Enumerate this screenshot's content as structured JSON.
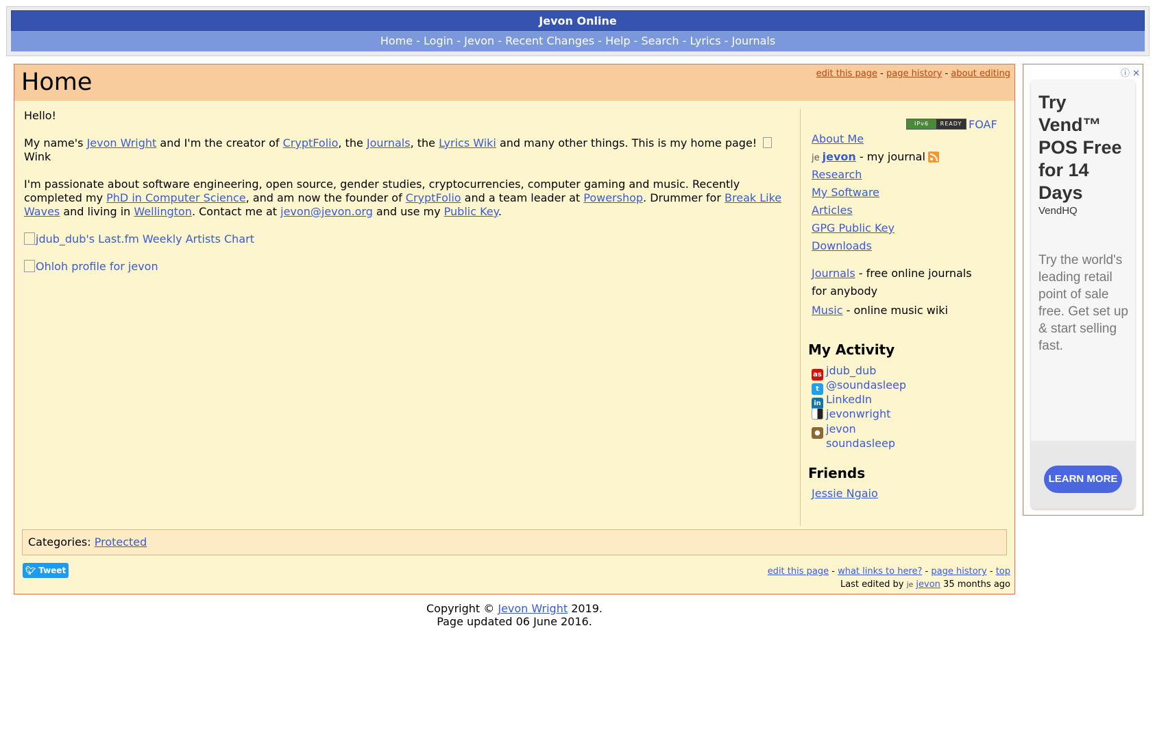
{
  "header": {
    "site_title": "Jevon Online",
    "nav": [
      "Home",
      "Login",
      "Jevon",
      "Recent Changes",
      "Help",
      "Search",
      "Lyrics",
      "Journals"
    ],
    "nav_separator": "-"
  },
  "page": {
    "title": "Home",
    "top_actions": [
      "edit this page",
      "page history",
      "about editing"
    ],
    "greeting": "Hello!",
    "intro": {
      "t1": "My name's ",
      "name_link": "Jevon Wright",
      "t2": " and I'm the creator of ",
      "cryptfolio_link": "CryptFolio",
      "t3": ", the ",
      "journals_link": "Journals",
      "t4": ", the ",
      "lyrics_link": "Lyrics Wiki",
      "t5": " and many other things. This is my home page! ",
      "wink_alt": "Wink"
    },
    "passion": {
      "t1": "I'm passionate about software engineering, open source, gender studies, cryptocurrencies, computer gaming and music. Recently completed my ",
      "phd_link": "PhD in Computer Science",
      "t2": ", and am now the founder of ",
      "cryptfolio_link": "CryptFolio",
      "t3": " and a team leader at ",
      "powershop_link": "Powershop",
      "t4": ". Drummer for ",
      "band_link": "Break Like Waves",
      "t5": " and living in ",
      "city_link": "Wellington",
      "t6": ". Contact me at ",
      "email_link": "jevon@jevon.org",
      "t7": " and use my ",
      "key_link": "Public Key",
      "t8": "."
    },
    "lastfm_chart_alt": "jdub_dub's Last.fm Weekly Artists Chart",
    "ohloh_alt": "Ohloh profile for jevon",
    "categories_label": "Categories: ",
    "category": "Protected",
    "tweet_label": "Tweet",
    "bottom_actions": [
      "edit this page",
      "what links to here?",
      "page history",
      "top"
    ],
    "last_edited_prefix": "Last edited by ",
    "last_edited_user": "jevon",
    "last_edited_suffix": " 35 months ago"
  },
  "sidebar": {
    "ipv6_left": "IPv6",
    "ipv6_right": "READY",
    "foaf": "FOAF",
    "links": {
      "about": "About Me",
      "journal_user": "jevon",
      "journal_suffix": " - my journal",
      "research": "Research",
      "software": "My Software",
      "articles": "Articles",
      "gpg": "GPG Public Key",
      "downloads": "Downloads"
    },
    "journals_link": "Journals",
    "journals_desc": " - free online journals for anybody",
    "music_link": "Music",
    "music_desc": " - online music wiki",
    "activity_heading": "My Activity",
    "activity": [
      {
        "label": "jdub_dub",
        "icon": "lastfm-icon"
      },
      {
        "label": "@soundasleep",
        "icon": "twitter-icon"
      },
      {
        "label": "LinkedIn",
        "icon": "linkedin-icon"
      },
      {
        "label": "jevonwright",
        "icon": "delicious-icon"
      },
      {
        "label": "jevon",
        "icon": "ohloh-icon"
      },
      {
        "label": "soundasleep",
        "icon": ""
      }
    ],
    "friends_heading": "Friends",
    "friends": [
      "Jessie Ngaio"
    ]
  },
  "footer": {
    "copyright_prefix": "Copyright © ",
    "copyright_name": "Jevon Wright",
    "copyright_year": " 2019.",
    "updated": "Page updated 06 June 2016."
  },
  "ad": {
    "headline": "Try Vend™ POS Free for 14 Days",
    "brand": "VendHQ",
    "description": "Try the world's leading retail point of sale free. Get set up & start selling fast.",
    "cta": "LEARN MORE",
    "info_glyph": "ⓘ",
    "close_glyph": "✕"
  },
  "colors": {
    "title_bar": "#3653b0",
    "nav_bar": "#7b98dc",
    "content_bg": "#fdf5cd",
    "title_strip": "#f9cc9e",
    "link": "#3a5ad6",
    "ad_cta": "#4a66e0"
  }
}
